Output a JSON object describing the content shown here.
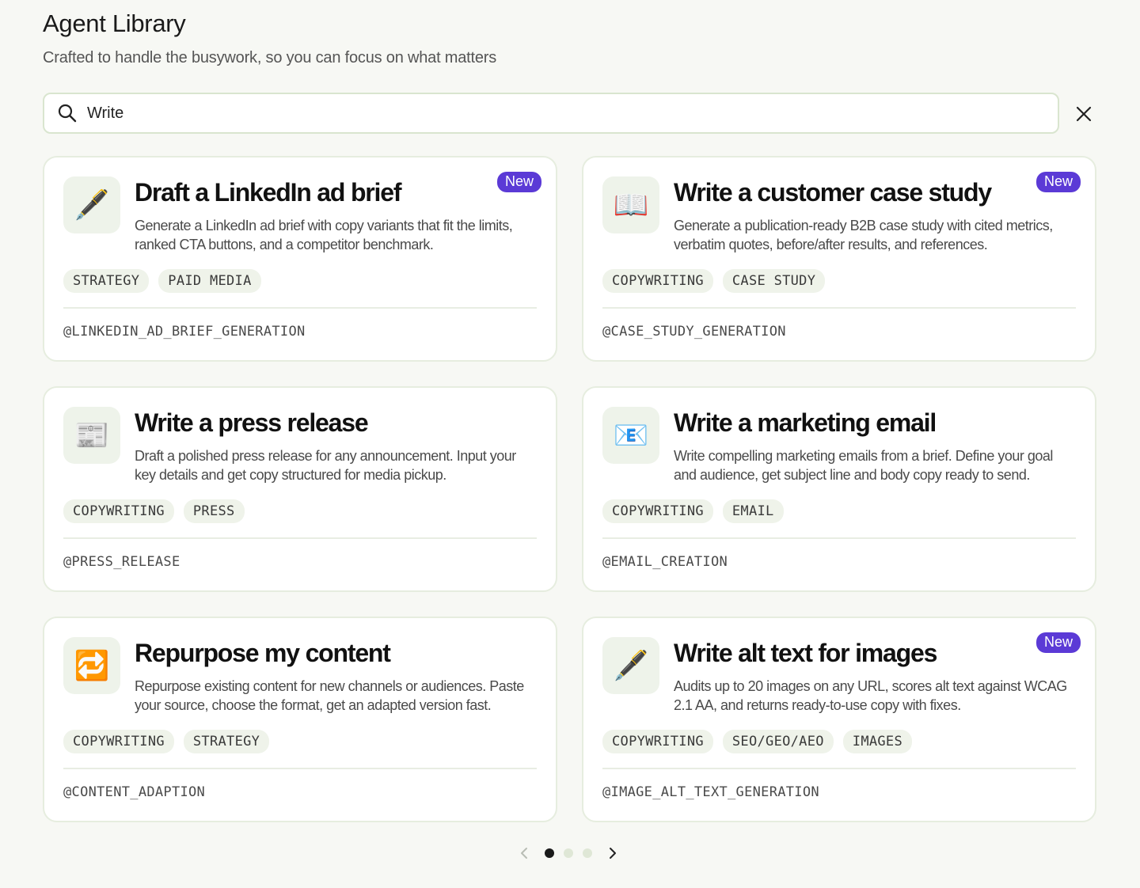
{
  "header": {
    "title": "Agent Library",
    "subtitle": "Crafted to handle the busywork, so you can focus on what matters"
  },
  "search": {
    "value": "Write",
    "icon": "search-icon",
    "clear_icon": "close-icon"
  },
  "colors": {
    "badge": "#5b3ad6",
    "tag_bg": "#eff3ea",
    "card_border": "#e6eddf"
  },
  "cards": [
    {
      "icon": "pen-icon",
      "emoji": "🖋️",
      "title": "Draft a LinkedIn ad brief",
      "badge": "New",
      "description": "Generate a LinkedIn ad brief with copy variants that fit the limits, ranked CTA buttons, and a competitor benchmark.",
      "tags": [
        "STRATEGY",
        "PAID MEDIA"
      ],
      "handle": "@LINKEDIN_AD_BRIEF_GENERATION"
    },
    {
      "icon": "book-icon",
      "emoji": "📖",
      "title": "Write a customer case study",
      "badge": "New",
      "description": "Generate a publication-ready B2B case study with cited metrics, verbatim quotes, before/after results, and references.",
      "tags": [
        "COPYWRITING",
        "CASE STUDY"
      ],
      "handle": "@CASE_STUDY_GENERATION"
    },
    {
      "icon": "newspaper-icon",
      "emoji": "📰",
      "title": "Write a press release",
      "badge": "",
      "description": "Draft a polished press release for any announcement. Input your key details and get copy structured for media pickup.",
      "tags": [
        "COPYWRITING",
        "PRESS"
      ],
      "handle": "@PRESS_RELEASE"
    },
    {
      "icon": "email-icon",
      "emoji": "📧",
      "title": "Write a marketing email",
      "badge": "",
      "description": "Write compelling marketing emails from a brief. Define your goal and audience, get subject line and body copy ready to send.",
      "tags": [
        "COPYWRITING",
        "EMAIL"
      ],
      "handle": "@EMAIL_CREATION"
    },
    {
      "icon": "repeat-icon",
      "emoji": "🔁",
      "title": "Repurpose my content",
      "badge": "",
      "description": "Repurpose existing content for new channels or audiences. Paste your source, choose the format, get an adapted version fast.",
      "tags": [
        "COPYWRITING",
        "STRATEGY"
      ],
      "handle": "@CONTENT_ADAPTION"
    },
    {
      "icon": "pen-icon",
      "emoji": "🖋️",
      "title": "Write alt text for images",
      "badge": "New",
      "description": "Audits up to 20 images on any URL, scores alt text against WCAG 2.1 AA, and returns ready-to-use copy with fixes.",
      "tags": [
        "COPYWRITING",
        "SEO/GEO/AEO",
        "IMAGES"
      ],
      "handle": "@IMAGE_ALT_TEXT_GENERATION"
    }
  ],
  "pagination": {
    "current_page": 1,
    "total_pages": 3
  }
}
